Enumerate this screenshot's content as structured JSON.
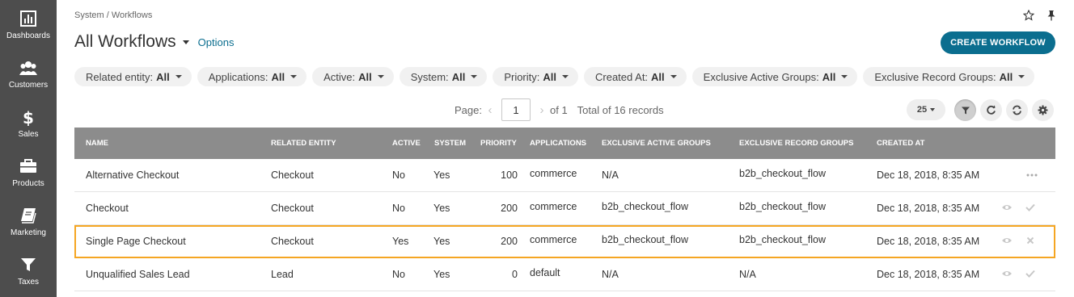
{
  "sidebar": {
    "items": [
      {
        "label": "Dashboards",
        "icon": "dashboard-icon"
      },
      {
        "label": "Customers",
        "icon": "customers-icon"
      },
      {
        "label": "Sales",
        "icon": "dollar-icon"
      },
      {
        "label": "Products",
        "icon": "briefcase-icon"
      },
      {
        "label": "Marketing",
        "icon": "book-icon"
      },
      {
        "label": "Taxes",
        "icon": "funnel-icon"
      }
    ]
  },
  "header": {
    "breadcrumb": "System / Workflows",
    "title": "All Workflows",
    "options_label": "Options",
    "create_label": "CREATE WORKFLOW"
  },
  "filters": [
    {
      "label": "Related entity:",
      "value": "All"
    },
    {
      "label": "Applications:",
      "value": "All"
    },
    {
      "label": "Active:",
      "value": "All"
    },
    {
      "label": "System:",
      "value": "All"
    },
    {
      "label": "Priority:",
      "value": "All"
    },
    {
      "label": "Created At:",
      "value": "All"
    },
    {
      "label": "Exclusive Active Groups:",
      "value": "All"
    },
    {
      "label": "Exclusive Record Groups:",
      "value": "All"
    }
  ],
  "pager": {
    "page_label": "Page:",
    "page_value": "1",
    "of_label": "of 1",
    "total_label": "Total of 16 records",
    "per_page": "25"
  },
  "table": {
    "columns": [
      "NAME",
      "RELATED ENTITY",
      "ACTIVE",
      "SYSTEM",
      "PRIORITY",
      "APPLICATIONS",
      "EXCLUSIVE ACTIVE GROUPS",
      "EXCLUSIVE RECORD GROUPS",
      "CREATED AT"
    ],
    "rows": [
      {
        "name": "Alternative Checkout",
        "entity": "Checkout",
        "active": "No",
        "system": "Yes",
        "priority": "100",
        "applications": "commerce",
        "active_groups": "N/A",
        "record_groups": "b2b_checkout_flow",
        "created": "Dec 18, 2018, 8:35 AM"
      },
      {
        "name": "Checkout",
        "entity": "Checkout",
        "active": "No",
        "system": "Yes",
        "priority": "200",
        "applications": "commerce",
        "active_groups": "b2b_checkout_flow",
        "record_groups": "b2b_checkout_flow",
        "created": "Dec 18, 2018, 8:35 AM"
      },
      {
        "name": "Single Page Checkout",
        "entity": "Checkout",
        "active": "Yes",
        "system": "Yes",
        "priority": "200",
        "applications": "commerce",
        "active_groups": "b2b_checkout_flow",
        "record_groups": "b2b_checkout_flow",
        "created": "Dec 18, 2018, 8:35 AM"
      },
      {
        "name": "Unqualified Sales Lead",
        "entity": "Lead",
        "active": "No",
        "system": "Yes",
        "priority": "0",
        "applications": "default",
        "active_groups": "N/A",
        "record_groups": "N/A",
        "created": "Dec 18, 2018, 8:35 AM"
      }
    ]
  },
  "colors": {
    "sidebar": "#4d4d4d",
    "accent": "#0b6e8f",
    "table_header": "#8c8c8c",
    "highlight": "#f5a623"
  }
}
